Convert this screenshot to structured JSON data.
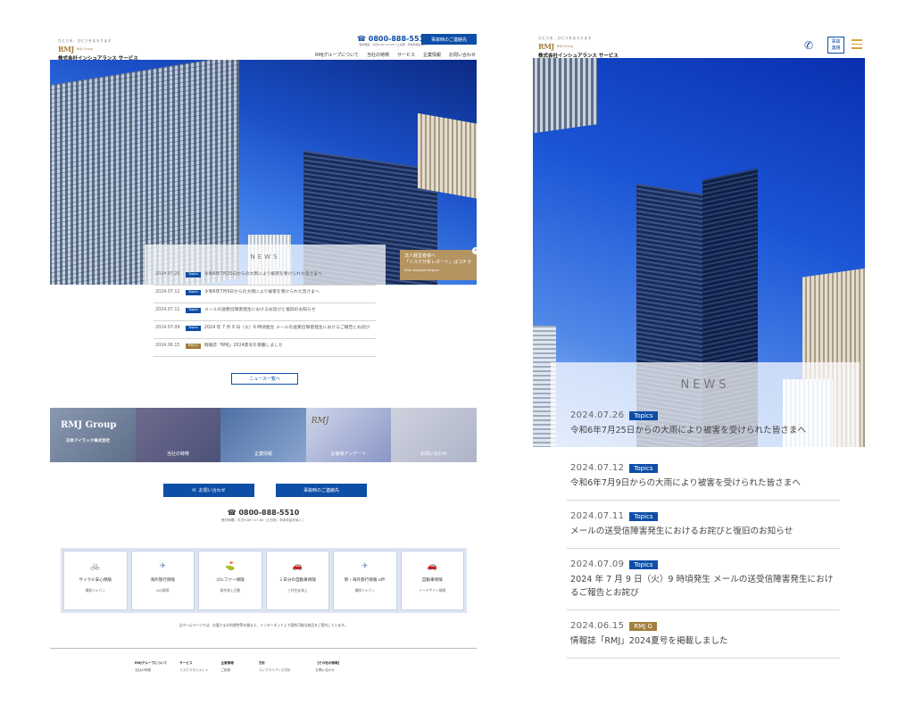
{
  "brand": {
    "tagline": "ひとりを、ひとりをまもります",
    "logo_mark": "RMJ",
    "logo_group": "RMJ Group",
    "company": "株式会社インシュアランス サービス"
  },
  "desktop": {
    "phone": "0800-888-5510",
    "phone_note": "受付時間：平日9:00〜17:00（土日祝、年末年始を除く）",
    "accident_button": "事故時のご連絡先",
    "nav": [
      "RMJグループについて",
      "当社の特徴",
      "サービス",
      "企業情報",
      "お問い合わせ"
    ],
    "banner": {
      "line1": "法人経営者様へ",
      "line2": "「リスク分析レポート」はコチラ",
      "line3": "Risk Analysis Report",
      "close": "×"
    },
    "news_title": "NEWS",
    "news": [
      {
        "date": "2024.07.26",
        "badge": "Topics",
        "text": "令和6年7月25日からの大雨により被害を受けられた皆さまへ"
      },
      {
        "date": "2024.07.12",
        "badge": "Topics",
        "text": "令和6年7月9日からの大雨により被害を受けられた皆さまへ"
      },
      {
        "date": "2024.07.11",
        "badge": "Topics",
        "text": "メールの送受信障害発生におけるお詫びと復旧のお知らせ"
      },
      {
        "date": "2024.07.09",
        "badge": "Topics",
        "text": "2024 年 7 月 9 日（火）9 時頃発生 メールの送受信障害発生におけるご報告とお詫び"
      },
      {
        "date": "2024.06.15",
        "badge": "RMJ G",
        "text": "情報誌「RMJ」2024夏号を掲載しました"
      }
    ],
    "news_more": "ニュース一覧へ",
    "tiles": [
      {
        "label": "",
        "mark": "RMJ Group",
        "mark2": "日本アイラック株式会社"
      },
      {
        "label": "当社の特徴"
      },
      {
        "label": "企業情報"
      },
      {
        "label": "お客様アンケート",
        "mark": "RMJ"
      },
      {
        "label": "お問い合わせ"
      }
    ],
    "contact_button": "お問い合わせ",
    "accident_button2": "事故時のご連絡先",
    "tel": "0800-888-5510",
    "tel_hours": "受付時間：平日9:00〜17:00（土日祝、年末年始を除く）",
    "insurance": [
      {
        "icon": "bicycle",
        "name": "サイクル安心保険",
        "company": "損保ジャパン"
      },
      {
        "icon": "airplane",
        "name": "海外旅行保険",
        "company": "AIG損保"
      },
      {
        "icon": "golf",
        "name": "ゴルファー保険",
        "company": "東京海上日動"
      },
      {
        "icon": "car",
        "name": "１日分の自動車保険",
        "company": "三井住友海上"
      },
      {
        "icon": "airplane",
        "name": "新・海外旅行保険 off!",
        "company": "損保ジャパン"
      },
      {
        "icon": "car",
        "name": "自動車保険",
        "company": "イーデザイン損保"
      }
    ],
    "disclaimer": "当ホームページでは、お客さまの利便性等を踏まえ、インターネット上で契約可能な商品をご案内しています。",
    "footer": [
      {
        "head": "RMJグループについて",
        "items": [
          "当社の特徴"
        ]
      },
      {
        "head": "サービス",
        "items": [
          "リスクマネジメント"
        ]
      },
      {
        "head": "企業情報",
        "items": [
          "ご挨拶"
        ]
      },
      {
        "head": "方針",
        "items": [
          "コンプライアンス方針"
        ]
      },
      {
        "head": "【その他の情報】",
        "items": [
          "お問い合わせ"
        ]
      }
    ]
  },
  "mobile": {
    "accident_button": "事故\n連絡",
    "news_title": "NEWS",
    "news": [
      {
        "date": "2024.07.26",
        "badge": "Topics",
        "text": "令和6年7月25日からの大雨により被害を受けられた皆さまへ"
      },
      {
        "date": "2024.07.12",
        "badge": "Topics",
        "text": "令和6年7月9日からの大雨により被害を受けられた皆さまへ"
      },
      {
        "date": "2024.07.11",
        "badge": "Topics",
        "text": "メールの送受信障害発生におけるお詫びと復旧のお知らせ"
      },
      {
        "date": "2024.07.09",
        "badge": "Topics",
        "text": "2024 年 7 月 9 日（火）9 時頃発生 メールの送受信障害発生におけるご報告とお詫び"
      },
      {
        "date": "2024.06.15",
        "badge": "RMJ G",
        "text": "情報誌「RMJ」2024夏号を掲載しました"
      }
    ]
  },
  "colors": {
    "brand_blue": "#0d4ea6",
    "brand_gold": "#a47f3c"
  }
}
